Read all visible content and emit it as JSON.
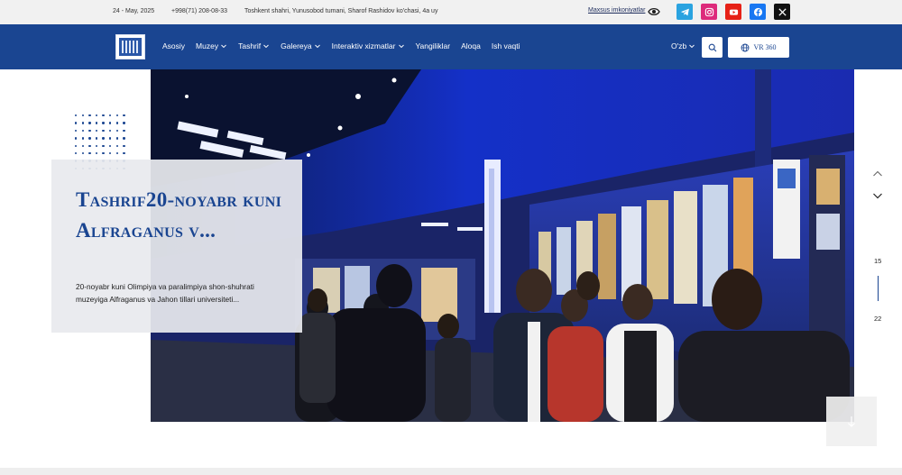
{
  "topbar": {
    "date": "24 - May, 2025",
    "phone": "+998(71) 208-08-33",
    "address": "Toshkent shahri, Yunusobod tumani, Sharof Rashidov ko'chasi, 4a uy",
    "accessibility_label": "Maxsus imkoniyatlar",
    "social": [
      {
        "name": "telegram-icon",
        "color": "#2aa3e0"
      },
      {
        "name": "instagram-icon",
        "color": "#e1306c"
      },
      {
        "name": "youtube-icon",
        "color": "#e62117"
      },
      {
        "name": "facebook-icon",
        "color": "#1877f2"
      },
      {
        "name": "x-icon",
        "color": "#111111"
      }
    ]
  },
  "nav": {
    "items": [
      {
        "label": "Asosiy",
        "dropdown": false
      },
      {
        "label": "Muzey",
        "dropdown": true
      },
      {
        "label": "Tashrif",
        "dropdown": true
      },
      {
        "label": "Galereya",
        "dropdown": true
      },
      {
        "label": "Interaktiv xizmatlar",
        "dropdown": true
      },
      {
        "label": "Yangiliklar",
        "dropdown": false
      },
      {
        "label": "Aloqa",
        "dropdown": false
      },
      {
        "label": "Ish vaqti",
        "dropdown": false
      }
    ],
    "language": "O'zb",
    "vr_label": "VR 360",
    "accent": "#1a4591"
  },
  "hero": {
    "title": "Tashrif20-noyabr kuni Alfraganus v...",
    "description": "20-noyabr kuni Olimpiya va paralimpiya shon-shuhrati muzeyiga Alfraganus va Jahon tillari universiteti..."
  },
  "slider": {
    "current": "15",
    "total": "22"
  }
}
